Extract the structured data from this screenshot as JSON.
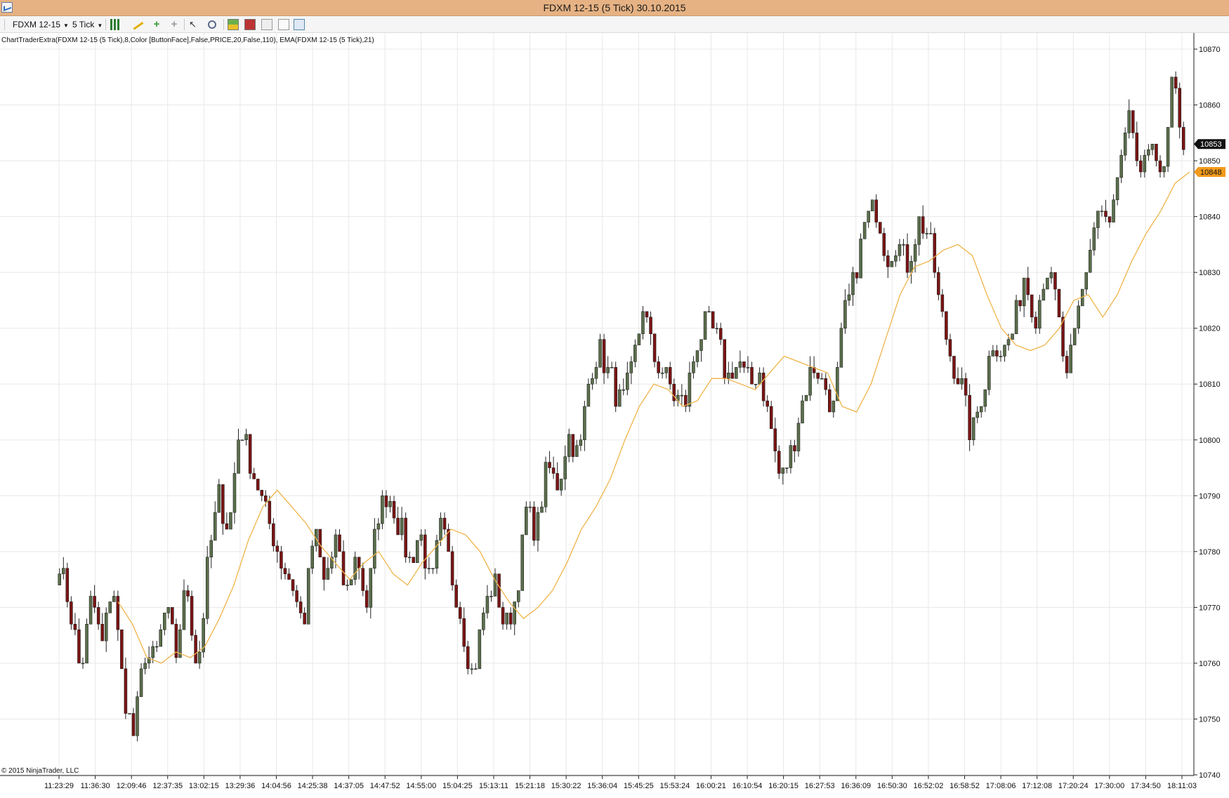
{
  "window": {
    "title": "FDXM 12-15 (5 Tick)  30.10.2015"
  },
  "toolbar": {
    "instrument": "FDXM 12-15",
    "interval": "5 Tick",
    "icons": [
      "chart-style-icon",
      "draw-tool-icon",
      "add-indicator-icon",
      "remove-indicator-icon",
      "pointer-icon",
      "zoom-icon",
      "chart-trader-icon",
      "data-box-icon",
      "properties-icon",
      "strategy-icon",
      "layout-icon"
    ]
  },
  "chart_data": {
    "type": "candlestick",
    "title": "",
    "indicator_label": "ChartTraderExtra(FDXM 12-15 (5 Tick),8,Color [ButtonFace],False,PRICE,20,False,110), EMA(FDXM 12-15 (5 Tick),21)",
    "copyright": "© 2015 NinjaTrader, LLC",
    "ylim": [
      10740,
      10870
    ],
    "y_ticks": [
      10870,
      10860,
      10850,
      10840,
      10830,
      10820,
      10810,
      10800,
      10790,
      10780,
      10770,
      10760,
      10750,
      10740
    ],
    "x_ticks": [
      "11:23:29",
      "11:36:30",
      "12:09:46",
      "12:37:35",
      "13:02:15",
      "13:29:36",
      "14:04:56",
      "14:25:38",
      "14:37:05",
      "14:47:52",
      "14:55:00",
      "15:04:25",
      "15:13:11",
      "15:21:18",
      "15:30:22",
      "15:36:04",
      "15:45:25",
      "15:53:24",
      "16:00:21",
      "16:10:54",
      "16:20:15",
      "16:27:53",
      "16:36:09",
      "16:50:30",
      "16:52:02",
      "16:58:52",
      "17:08:06",
      "17:12:08",
      "17:20:24",
      "17:30:00",
      "17:34:50",
      "18:11:03"
    ],
    "close_path": [
      10778,
      10770,
      10758,
      10772,
      10763,
      10775,
      10755,
      10747,
      10762,
      10760,
      10770,
      10762,
      10775,
      10758,
      10778,
      10790,
      10784,
      10803,
      10796,
      10790,
      10784,
      10778,
      10774,
      10766,
      10784,
      10774,
      10782,
      10772,
      10780,
      10770,
      10787,
      10791,
      10785,
      10778,
      10784,
      10773,
      10785,
      10776,
      10767,
      10757,
      10769,
      10775,
      10766,
      10771,
      10787,
      10784,
      10795,
      10792,
      10801,
      10797,
      10812,
      10816,
      10811,
      10806,
      10812,
      10824,
      10815,
      10812,
      10808,
      10806,
      10817,
      10821,
      10818,
      10811,
      10814,
      10810,
      10812,
      10803,
      10793,
      10798,
      10806,
      10814,
      10810,
      10806,
      10822,
      10829,
      10839,
      10842,
      10833,
      10836,
      10831,
      10839,
      10837,
      10824,
      10815,
      10810,
      10800,
      10808,
      10818,
      10816,
      10820,
      10830,
      10822,
      10831,
      10825,
      10810,
      10822,
      10833,
      10842,
      10838,
      10848,
      10858,
      10845,
      10856,
      10844,
      10865,
      10853
    ],
    "ema": {
      "name": "EMA(21)",
      "values": [
        10771,
        10767,
        10761,
        10760,
        10762,
        10761,
        10763,
        10768,
        10774,
        10782,
        10788,
        10791,
        10788,
        10785,
        10781,
        10778,
        10775,
        10778,
        10780,
        10776,
        10774,
        10778,
        10781,
        10784,
        10783,
        10780,
        10775,
        10771,
        10768,
        10770,
        10773,
        10778,
        10784,
        10788,
        10793,
        10800,
        10806,
        10810,
        10809,
        10806,
        10807,
        10811,
        10811,
        10810,
        10809,
        10812,
        10815,
        10814,
        10813,
        10812,
        10806,
        10805,
        10810,
        10818,
        10826,
        10831,
        10832,
        10834,
        10835,
        10833,
        10826,
        10820,
        10817,
        10816,
        10817,
        10820,
        10825,
        10826,
        10822,
        10826,
        10832,
        10837,
        10841,
        10846,
        10848
      ]
    },
    "last_price": "10853",
    "ema_last": "10848",
    "colors": {
      "up_candle": "#5a6e4b",
      "down_candle": "#7a1515",
      "wick": "#222222",
      "ema_line": "#f0b44a",
      "grid": "#e8e8e8",
      "last_price_tag": "#111111",
      "ema_tag": "#f29a1c"
    }
  }
}
